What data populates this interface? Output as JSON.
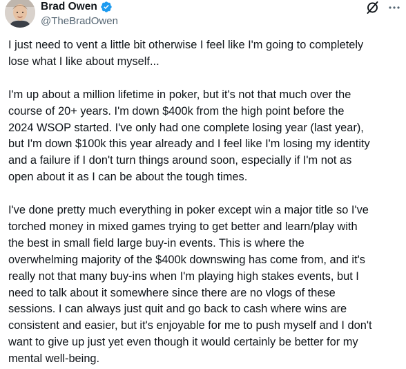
{
  "author": {
    "display_name": "Brad Owen",
    "handle": "@TheBradOwen",
    "verified": true,
    "verified_color": "#1d9bf0",
    "avatar_icon": "profile-photo"
  },
  "header_actions": {
    "grok_icon": "grok-slash-circle-icon",
    "more_icon": "more-dots-icon"
  },
  "tweet": {
    "paragraphs": [
      "I just need to vent a little bit otherwise I feel like I'm going to completely\nlose what I like about myself...",
      "I'm up about a million lifetime in poker, but it's not that much over the\ncourse of 20+ years. I'm down $400k from the high point before the\n2024 WSOP started. I've only had one complete losing year (last year),\nbut I'm down $100k this year already and I feel like I'm losing my identity\nand a failure if I don't turn things around soon, especially if I'm not as\nopen about it as I can be about the tough times.",
      "I've done pretty much everything in poker except win a major title so I've\ntorched money in mixed games trying to get better and learn/play with\nthe best in small field large buy-in events. This is where the\noverwhelming majority of the $400k downswing has come from, and it's\nreally not that many buy-ins when I'm playing high stakes events, but I\nneed to talk about it somewhere since there are no vlogs of these\nsessions. I can always just quit and go back to cash where wins are\nconsistent and easier, but it's enjoyable for me to push myself and I don't\nwant to give up just yet even though it would certainly be better for my\nmental well-being."
    ]
  },
  "colors": {
    "text_primary": "#0f1419",
    "text_secondary": "#536471",
    "background": "#ffffff"
  }
}
